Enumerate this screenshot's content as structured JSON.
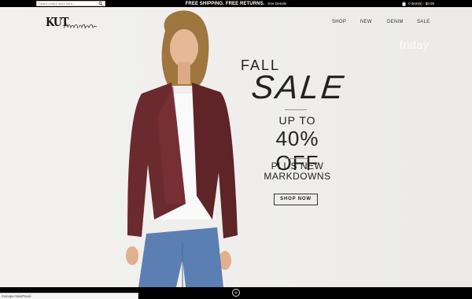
{
  "search": {
    "placeholder": "Search entire store here..."
  },
  "promo": {
    "text": "FREE SHIPPING. FREE RETURNS.",
    "details": "See Details"
  },
  "cart": {
    "label": "0 item(s) - $0.00"
  },
  "nav": {
    "items": [
      "SHOP",
      "NEW",
      "DENIM",
      "SALE"
    ]
  },
  "watermark": "friday",
  "hero": {
    "fall": "FALL",
    "sale": "SALE",
    "up_to": "UP TO",
    "percent": "40% OFF",
    "plus_line1": "PLUS NEW",
    "plus_line2": "MARKDOWNS",
    "button": "SHOP NOW"
  },
  "status_url": "mscape:SalePanel",
  "colors": {
    "jacket": "#6b2a2e",
    "denim": "#5b7fb3",
    "background": "#efeeec"
  }
}
